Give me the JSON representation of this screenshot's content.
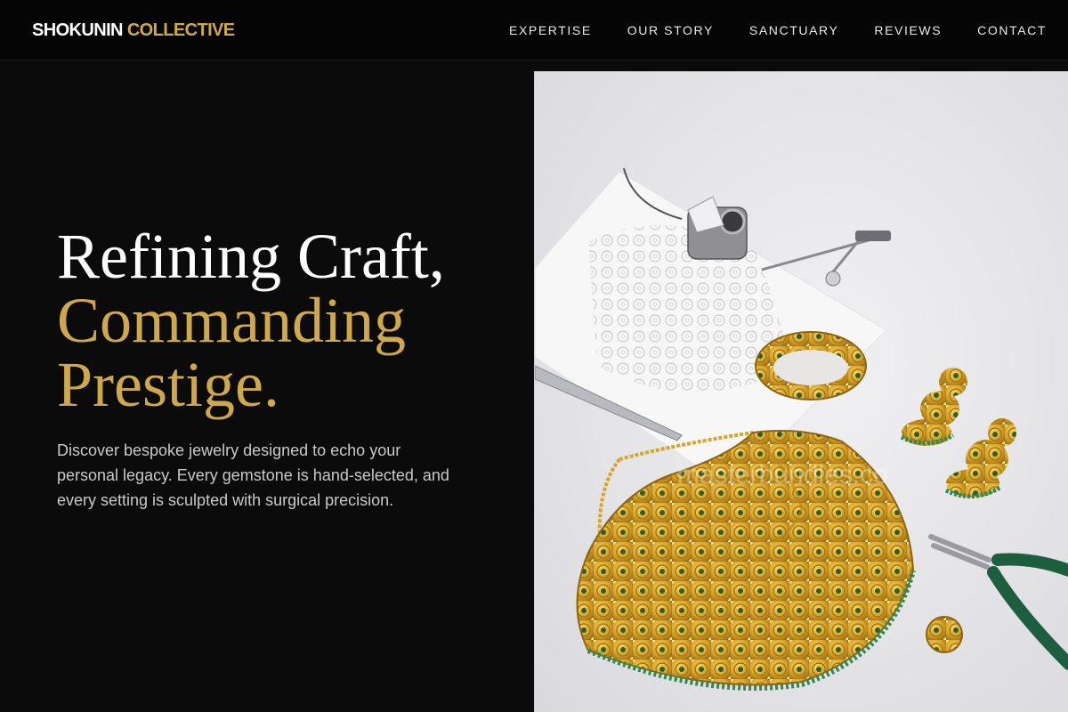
{
  "brand": {
    "name_primary": "SHOKUNIN",
    "name_accent": "COLLECTIVE"
  },
  "nav": {
    "items": [
      {
        "label": "EXPERTISE"
      },
      {
        "label": "OUR STORY"
      },
      {
        "label": "SANCTUARY"
      },
      {
        "label": "REVIEWS"
      },
      {
        "label": "CONTACT"
      }
    ]
  },
  "hero": {
    "headline_line1": "Refining Craft,",
    "headline_line2": "Commanding",
    "headline_line3": "Prestige.",
    "description": "Discover bespoke jewelry designed to echo your personal legacy. Every gemstone is hand-selected, and every setting is sculpted with surgical precision.",
    "image": {
      "watermark": "masterbundles.co"
    }
  },
  "colors": {
    "background": "#0b0b0b",
    "accent_gold": "#cfa84a",
    "text_primary": "#ffffff",
    "text_secondary": "#c9c9c9",
    "photo_background": "#e6e6e9"
  }
}
